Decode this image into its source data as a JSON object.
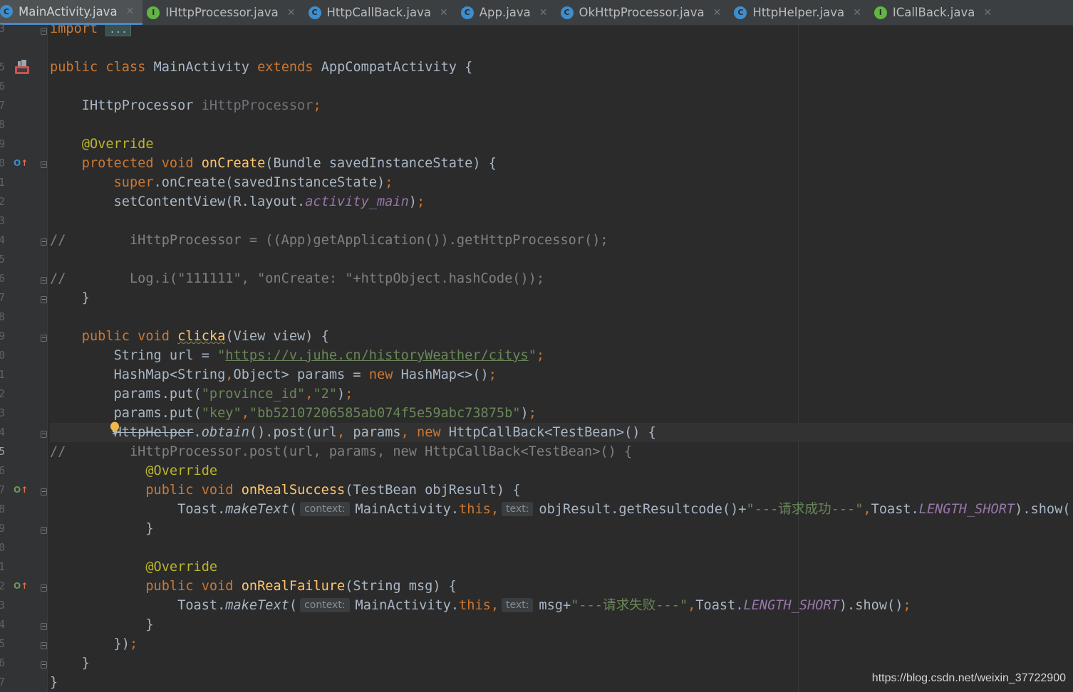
{
  "tabs": [
    {
      "label": "MainActivity.java",
      "icon": "class-icon",
      "icon_letter": "C",
      "kind": "c"
    },
    {
      "label": "IHttpProcessor.java",
      "icon": "interface-icon",
      "icon_letter": "I",
      "kind": "i"
    },
    {
      "label": "HttpCallBack.java",
      "icon": "abstract-class-icon",
      "icon_letter": "C",
      "kind": "c"
    },
    {
      "label": "App.java",
      "icon": "class-icon",
      "icon_letter": "C",
      "kind": "c"
    },
    {
      "label": "OkHttpProcessor.java",
      "icon": "class-icon",
      "icon_letter": "C",
      "kind": "c"
    },
    {
      "label": "HttpHelper.java",
      "icon": "class-icon",
      "icon_letter": "C",
      "kind": "c"
    },
    {
      "label": "ICallBack.java",
      "icon": "interface-icon",
      "icon_letter": "I",
      "kind": "i"
    }
  ],
  "active_tab": "MainActivity.java",
  "line_numbers": [
    "3",
    "",
    "5",
    "6",
    "7",
    "8",
    "9",
    "0",
    "1",
    "2",
    "3",
    "4",
    "5",
    "6",
    "7",
    "8",
    "9",
    "0",
    "1",
    "2",
    "3",
    "4",
    "5",
    "6",
    "7",
    "8",
    "9",
    "0",
    "1",
    "2",
    "3",
    "4",
    "5",
    "6",
    "7",
    "8"
  ],
  "current_line_number": "5",
  "code": {
    "import_kw": "import",
    "import_fold": "...",
    "l6": {
      "kw1": "public",
      "kw2": "class",
      "name": "MainActivity",
      "kw3": "extends",
      "base": "AppCompatActivity {"
    },
    "l8": {
      "type": "IHttpProcessor ",
      "field": "iHttpProcessor",
      "semi": ";"
    },
    "l10": "@Override",
    "l11": {
      "kw1": "protected",
      "kw2": "void",
      "fn": "onCreate",
      "rest": "(Bundle savedInstanceState) {"
    },
    "l12": {
      "kw": "super",
      "rest": ".onCreate(savedInstanceState)",
      "semi": ";"
    },
    "l13": {
      "pre": "setContentView(R.layout.",
      "field": "activity_main",
      "post": ")",
      "semi": ";"
    },
    "l15": {
      "slashes": "//",
      "text": "iHttpProcessor = ((App)getApplication()).getHttpProcessor();"
    },
    "l17": {
      "slashes": "//",
      "text": "Log.i(\"111111\", \"onCreate: \"+httpObject.hashCode());"
    },
    "l18": "}",
    "l20": {
      "kw1": "public",
      "kw2": "void",
      "fn": "clicka",
      "rest": "(View view) {"
    },
    "l21": {
      "pre": "String url = ",
      "q1": "\"",
      "url": "https://v.juhe.cn/historyWeather/citys",
      "q2": "\"",
      "semi": ";"
    },
    "l22": {
      "pre": "HashMap<String",
      "comma": ",",
      "mid": "Object> params = ",
      "kw": "new",
      "post": " HashMap<>()",
      "semi": ";"
    },
    "l23": {
      "pre": "params.put(",
      "s1": "\"province_id\"",
      "comma": ",",
      "s2": "\"2\"",
      "post": ")",
      "semi": ";"
    },
    "l24": {
      "pre": "params.put(",
      "s1": "\"key\"",
      "comma": ",",
      "s2": "\"bb52107206585ab074f5e59abc73875b\"",
      "post": ")",
      "semi": ";"
    },
    "l25": {
      "cls": "HttpHelper",
      "dot": ".",
      "method": "obtain",
      "mid": "().post(url",
      "c1": ",",
      "p": " params",
      "c2": ",",
      "kw": "new",
      "post": " HttpCallBack<TestBean>() {"
    },
    "l26": {
      "slashes": "//",
      "text": "iHttpProcessor.post(url, params, new HttpCallBack<TestBean>() {"
    },
    "l27": "@Override",
    "l28": {
      "kw1": "public",
      "kw2": "void",
      "fn": "onRealSuccess",
      "rest": "(TestBean objResult) {"
    },
    "l29": {
      "pre": "Toast.",
      "method": "makeText",
      "paren": "(",
      "hint1": "context:",
      "arg1": "MainActivity.",
      "kw": "this",
      "comma": ",",
      "hint2": "text:",
      "arg2": "objResult.getResultcode()+",
      "str": "\"---请求成功---\"",
      "c2": ",",
      "post1": "Toast.",
      "const": "LENGTH_SHORT",
      "post2": ").show()",
      "semi": ";"
    },
    "l30": "}",
    "l32": "@Override",
    "l33": {
      "kw1": "public",
      "kw2": "void",
      "fn": "onRealFailure",
      "rest": "(String msg) {"
    },
    "l34": {
      "pre": "Toast.",
      "method": "makeText",
      "paren": "(",
      "hint1": "context:",
      "arg1": "MainActivity.",
      "kw": "this",
      "comma": ",",
      "hint2": "text:",
      "arg2": "msg+",
      "str": "\"---请求失败---\"",
      "c2": ",",
      "post1": "Toast.",
      "const": "LENGTH_SHORT",
      "post2": ").show()",
      "semi": ";"
    },
    "l35": "}",
    "l36": {
      "text": "})",
      "semi": ";"
    },
    "l37": "}",
    "l38": "}"
  },
  "watermark": "https://blog.csdn.net/weixin_37722900",
  "colors": {
    "background": "#2b2b2b",
    "keyword": "#cc7832",
    "string": "#6a8759",
    "function": "#ffc66d",
    "annotation": "#bbb529",
    "field": "#9876aa",
    "comment": "#808080",
    "text": "#a9b7c6",
    "tab_active_underline": "#4a88c7"
  }
}
